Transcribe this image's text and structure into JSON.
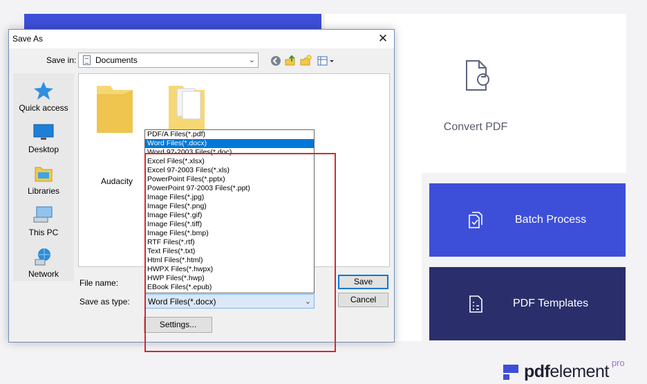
{
  "background_app": {
    "convert_label": "Convert PDF",
    "batch_label": "Batch Process",
    "templates_label": "PDF Templates",
    "brand": {
      "pdf": "pdf",
      "element": "element",
      "pro": "pro"
    },
    "colors": {
      "accent": "#3d4fd8",
      "dark_tile": "#2a2f6b",
      "highlight": "#d9252f"
    }
  },
  "dialog": {
    "title": "Save As",
    "close_icon": "close-icon",
    "save_in_label": "Save in:",
    "save_in_value": "Documents",
    "toolbar_icons": [
      "back-icon",
      "up-folder-icon",
      "new-folder-icon",
      "views-menu-icon"
    ],
    "places": [
      {
        "label": "Quick access",
        "icon": "star-icon"
      },
      {
        "label": "Desktop",
        "icon": "desktop-icon"
      },
      {
        "label": "Libraries",
        "icon": "libraries-icon"
      },
      {
        "label": "This PC",
        "icon": "computer-icon"
      },
      {
        "label": "Network",
        "icon": "network-icon"
      }
    ],
    "folders": [
      {
        "label": "Audacity"
      },
      {
        "label": ""
      }
    ],
    "file_name_label": "File name:",
    "save_as_type_label": "Save as type:",
    "save_as_type_value": "Word Files(*.docx)",
    "save_button": "Save",
    "cancel_button": "Cancel",
    "settings_button": "Settings...",
    "file_types": [
      "PDF/A Files(*.pdf)",
      "Word Files(*.docx)",
      "Word 97-2003 Files(*.doc)",
      "Excel Files(*.xlsx)",
      "Excel 97-2003 Files(*.xls)",
      "PowerPoint Files(*.pptx)",
      "PowerPoint 97-2003 Files(*.ppt)",
      "Image Files(*.jpg)",
      "Image Files(*.png)",
      "Image Files(*.gif)",
      "Image Files(*.tiff)",
      "Image Files(*.bmp)",
      "RTF Files(*.rtf)",
      "Text Files(*.txt)",
      "Html Files(*.html)",
      "HWPX Files(*.hwpx)",
      "HWP Files(*.hwp)",
      "EBook Files(*.epub)"
    ],
    "selected_file_type_index": 1
  }
}
